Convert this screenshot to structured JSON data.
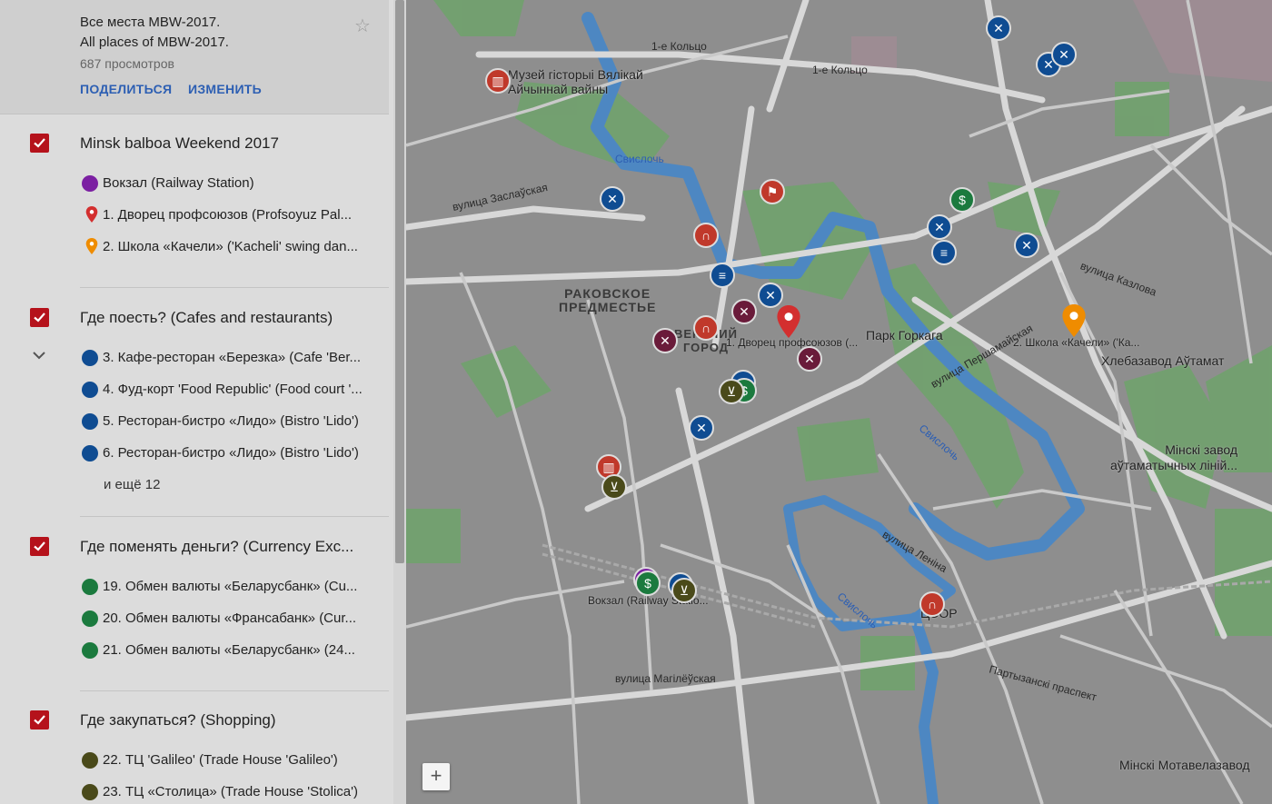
{
  "map_info": {
    "title_ru": "Все места MBW-2017.",
    "title_en": "All places of MBW-2017.",
    "views": "687 просмотров",
    "share_label": "ПОДЕЛИТЬСЯ",
    "edit_label": "ИЗМЕНИТЬ"
  },
  "layers": [
    {
      "title": "Minsk balboa Weekend 2017",
      "items": [
        {
          "text": "Вокзал (Railway Station)",
          "color": "#7b1fa2",
          "icon": "train-icon"
        },
        {
          "text": "1. Дворец профсоюзов (Profsoyuz Pal...",
          "color": "#d32f2f",
          "icon": "pin-icon"
        },
        {
          "text": "2. Школа «Качели» ('Kacheli' swing dan...",
          "color": "#ef8c00",
          "icon": "pin-icon"
        }
      ]
    },
    {
      "title": "Где поесть? (Cafes and restaurants)",
      "items": [
        {
          "text": "3. Кафе-ресторан «Березка» (Cafe 'Ber...",
          "color": "#0f4c92",
          "icon": "restaurant-icon"
        },
        {
          "text": "4. Фуд-корт 'Food Republic' (Food court '...",
          "color": "#0f4c92",
          "icon": "restaurant-icon"
        },
        {
          "text": "5. Ресторан-бистро «Лидо» (Bistro 'Lido')",
          "color": "#0f4c92",
          "icon": "restaurant-icon"
        },
        {
          "text": "6. Ресторан-бистро «Лидо» (Bistro 'Lido')",
          "color": "#0f4c92",
          "icon": "restaurant-icon"
        }
      ],
      "more": "и ещё 12"
    },
    {
      "title": "Где поменять деньги? (Currency Exc...",
      "items": [
        {
          "text": "19. Обмен валюты «Беларусбанк» (Cu...",
          "color": "#1b7a3e",
          "icon": "dollar-icon"
        },
        {
          "text": "20. Обмен валюты «Франсабанк» (Cur...",
          "color": "#1b7a3e",
          "icon": "dollar-icon"
        },
        {
          "text": "21. Обмен валюты «Беларусбанк»  (24...",
          "color": "#1b7a3e",
          "icon": "dollar-icon"
        }
      ]
    },
    {
      "title": "Где закупаться? (Shopping)",
      "items": [
        {
          "text": "22. ТЦ 'Galileo' (Trade House 'Galileo')",
          "color": "#4a4a1a",
          "icon": "cart-icon"
        },
        {
          "text": "23. ТЦ «Столица» (Trade House 'Stolica')",
          "color": "#4a4a1a",
          "icon": "cart-icon"
        }
      ]
    }
  ],
  "map_labels": {
    "museum": "Музей гісторыі Вялікай\nАйчыннай вайны",
    "district": "РАКОВСКОЕ\nПРЕДМЕСТЬЕ",
    "upper_town": "ВЕРХНИЙ\nГОРОД",
    "park": "Парк Горкага",
    "bakery": "Хлебазавод Аўтамат",
    "auto_lines": "Мінскі завод\nаўтаматычных ліній...",
    "motor": "Мінскі Мотавелазавод",
    "poi1": "1. Дворец профсоюзов (...",
    "poi2": "2. Школа «Качели» ('Ка...",
    "station": "Вокзал (Railway Statio...",
    "tsor": "ЦЭОР",
    "river1": "Свислочь",
    "river2": "Свислочь",
    "river3": "Свислочь",
    "ring1": "1-е Кольцо",
    "ring2": "1-е Кольцо",
    "pershamai": "вулица Першамайская",
    "partyzanski": "Партызанскі праспект",
    "magilyouskaya": "вулица Магілёўская",
    "kazlova": "вулица Казлова",
    "lenina": "вулица Леніна",
    "zamashchy": "вулица Заслаўская",
    "zoom": "+"
  },
  "colors": {
    "checkbox": "#b5121b",
    "link": "#2d5fb3",
    "restaurant": "#0f4c92",
    "exchange": "#1b7a3e",
    "shopping": "#4a4a1a",
    "landmark": "#c0392b",
    "hotel": "#6a1b3a"
  }
}
